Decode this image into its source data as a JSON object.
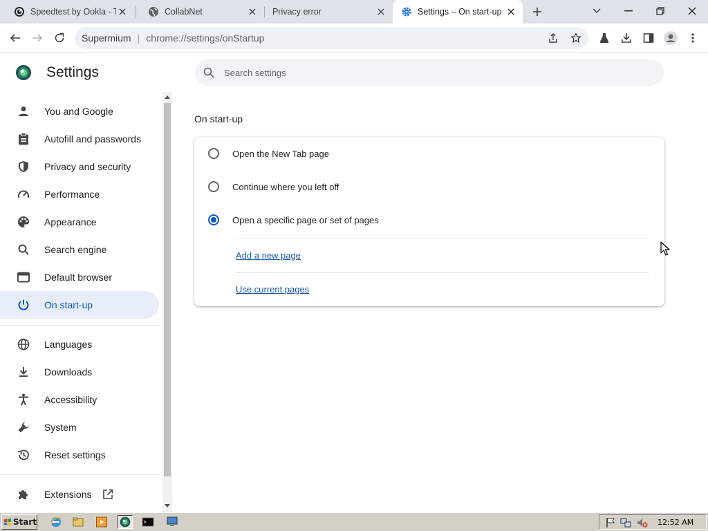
{
  "browser": {
    "tabs": [
      {
        "title": "Speedtest by Ookla - T",
        "icon": "speedtest-icon",
        "active": false
      },
      {
        "title": "CollabNet",
        "icon": "globe-icon",
        "active": false
      },
      {
        "title": "Privacy error",
        "icon": "none",
        "active": false
      },
      {
        "title": "Settings – On start-up",
        "icon": "gear-icon",
        "active": true
      }
    ],
    "omnibox": {
      "site": "Supermium",
      "url": "chrome://settings/onStartup"
    }
  },
  "settings": {
    "title": "Settings",
    "search_placeholder": "Search settings",
    "nav": [
      {
        "label": "You and Google",
        "icon": "person-icon",
        "selected": false
      },
      {
        "label": "Autofill and passwords",
        "icon": "clipboard-icon",
        "selected": false
      },
      {
        "label": "Privacy and security",
        "icon": "shield-icon",
        "selected": false
      },
      {
        "label": "Performance",
        "icon": "speedometer-icon",
        "selected": false
      },
      {
        "label": "Appearance",
        "icon": "palette-icon",
        "selected": false
      },
      {
        "label": "Search engine",
        "icon": "search-icon",
        "selected": false
      },
      {
        "label": "Default browser",
        "icon": "browser-window-icon",
        "selected": false
      },
      {
        "label": "On start-up",
        "icon": "power-icon",
        "selected": true
      },
      {
        "label": "Languages",
        "icon": "globe-icon",
        "selected": false
      },
      {
        "label": "Downloads",
        "icon": "download-icon",
        "selected": false
      },
      {
        "label": "Accessibility",
        "icon": "accessibility-icon",
        "selected": false
      },
      {
        "label": "System",
        "icon": "wrench-icon",
        "selected": false
      },
      {
        "label": "Reset settings",
        "icon": "restore-icon",
        "selected": false
      },
      {
        "label": "Extensions",
        "icon": "puzzle-icon",
        "selected": false
      }
    ],
    "section_title": "On start-up",
    "options": [
      {
        "label": "Open the New Tab page",
        "checked": false
      },
      {
        "label": "Continue where you left off",
        "checked": false
      },
      {
        "label": "Open a specific page or set of pages",
        "checked": true
      }
    ],
    "links": {
      "add_page": "Add a new page",
      "use_current": "Use current pages"
    }
  },
  "taskbar": {
    "start_label": "Start",
    "clock": "12:52 AM"
  },
  "colors": {
    "accent": "#0b57d0",
    "nav_selected_bg": "#e7eef9",
    "tabstrip_bg": "#dee3ea",
    "link": "#1a56a8"
  }
}
